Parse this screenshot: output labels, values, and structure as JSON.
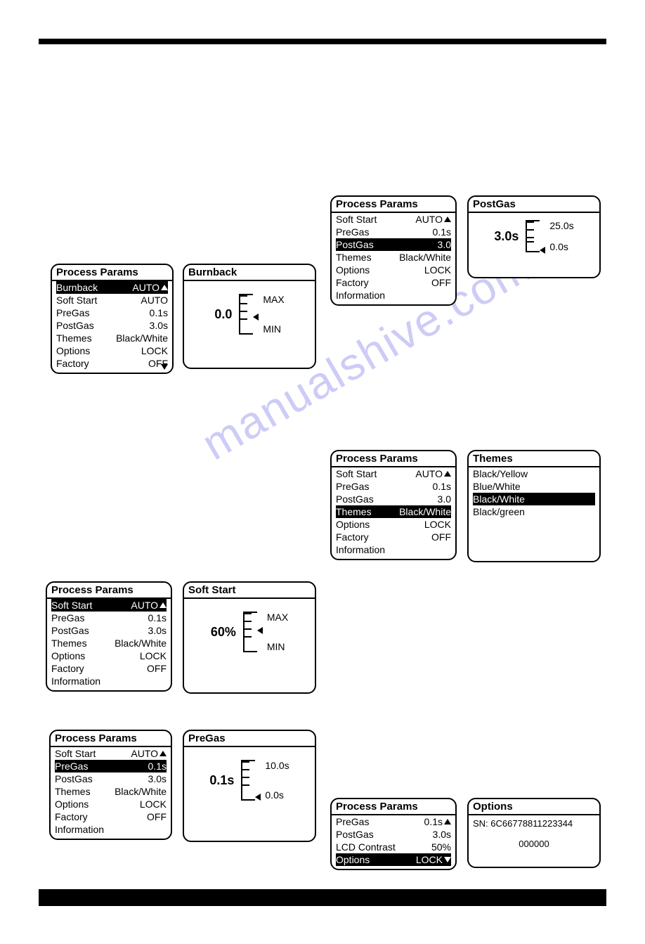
{
  "panel1": {
    "title": "Process Params",
    "rows": [
      {
        "label": "Burnback",
        "value": "AUTO",
        "sel": true,
        "arrow": "up"
      },
      {
        "label": "Soft Start",
        "value": "AUTO"
      },
      {
        "label": "PreGas",
        "value": "0.1s"
      },
      {
        "label": "PostGas",
        "value": "3.0s"
      },
      {
        "label": "Themes",
        "value": "Black/White"
      },
      {
        "label": "Options",
        "value": "LOCK"
      },
      {
        "label": "Factory",
        "value": "OFF"
      }
    ],
    "bottomArrow": "down"
  },
  "panel2": {
    "title": "Burnback",
    "value": "0.0",
    "max": "MAX",
    "min": "MIN"
  },
  "panel3": {
    "title": "Process Params",
    "rows": [
      {
        "label": "Soft Start",
        "value": "AUTO",
        "arrow": "up"
      },
      {
        "label": "PreGas",
        "value": "0.1s"
      },
      {
        "label": "PostGas",
        "value": "3.0",
        "sel": true
      },
      {
        "label": "Themes",
        "value": "Black/White"
      },
      {
        "label": "Options",
        "value": "LOCK"
      },
      {
        "label": "Factory",
        "value": "OFF"
      },
      {
        "label": "Information",
        "value": ""
      }
    ]
  },
  "panel4": {
    "title": "PostGas",
    "value": "3.0s",
    "max": "25.0s",
    "min": "0.0s"
  },
  "panel5": {
    "title": "Process Params",
    "rows": [
      {
        "label": "Soft Start",
        "value": "AUTO",
        "arrow": "up"
      },
      {
        "label": "PreGas",
        "value": "0.1s"
      },
      {
        "label": "PostGas",
        "value": "3.0"
      },
      {
        "label": "Themes",
        "value": "Black/White",
        "sel": true
      },
      {
        "label": "Options",
        "value": "LOCK"
      },
      {
        "label": "Factory",
        "value": "OFF"
      },
      {
        "label": "Information",
        "value": ""
      }
    ]
  },
  "panel6": {
    "title": "Themes",
    "items": [
      {
        "label": "Black/Yellow"
      },
      {
        "label": "Blue/White"
      },
      {
        "label": "Black/White",
        "sel": true
      },
      {
        "label": "Black/green"
      }
    ]
  },
  "panel7": {
    "title": "Process Params",
    "rows": [
      {
        "label": "Soft Start",
        "value": "AUTO",
        "sel": true,
        "arrow": "up"
      },
      {
        "label": "PreGas",
        "value": "0.1s"
      },
      {
        "label": "PostGas",
        "value": "3.0s"
      },
      {
        "label": "Themes",
        "value": "Black/White"
      },
      {
        "label": "Options",
        "value": "LOCK"
      },
      {
        "label": "Factory",
        "value": "OFF"
      },
      {
        "label": "Information",
        "value": ""
      }
    ]
  },
  "panel8": {
    "title": "Soft Start",
    "value": "60%",
    "max": "MAX",
    "min": "MIN"
  },
  "panel9": {
    "title": "Process Params",
    "rows": [
      {
        "label": "Soft Start",
        "value": "AUTO",
        "arrow": "up"
      },
      {
        "label": "PreGas",
        "value": "0.1s",
        "sel": true
      },
      {
        "label": "PostGas",
        "value": "3.0s"
      },
      {
        "label": "Themes",
        "value": "Black/White"
      },
      {
        "label": "Options",
        "value": "LOCK"
      },
      {
        "label": "Factory",
        "value": "OFF"
      },
      {
        "label": "Information",
        "value": ""
      }
    ]
  },
  "panel10": {
    "title": "PreGas",
    "value": "0.1s",
    "max": "10.0s",
    "min": "0.0s"
  },
  "panel11": {
    "title": "Process Params",
    "rows": [
      {
        "label": "PreGas",
        "value": "0.1s",
        "arrow": "up"
      },
      {
        "label": "PostGas",
        "value": "3.0s"
      },
      {
        "label": "LCD Contrast",
        "value": "50%"
      },
      {
        "label": "Options",
        "value": "LOCK",
        "sel": true,
        "arrow": "down"
      }
    ]
  },
  "panel12": {
    "title": "Options",
    "sn": "SN: 6C66778811223344",
    "code": "000000"
  },
  "watermark": "manualshive.com"
}
